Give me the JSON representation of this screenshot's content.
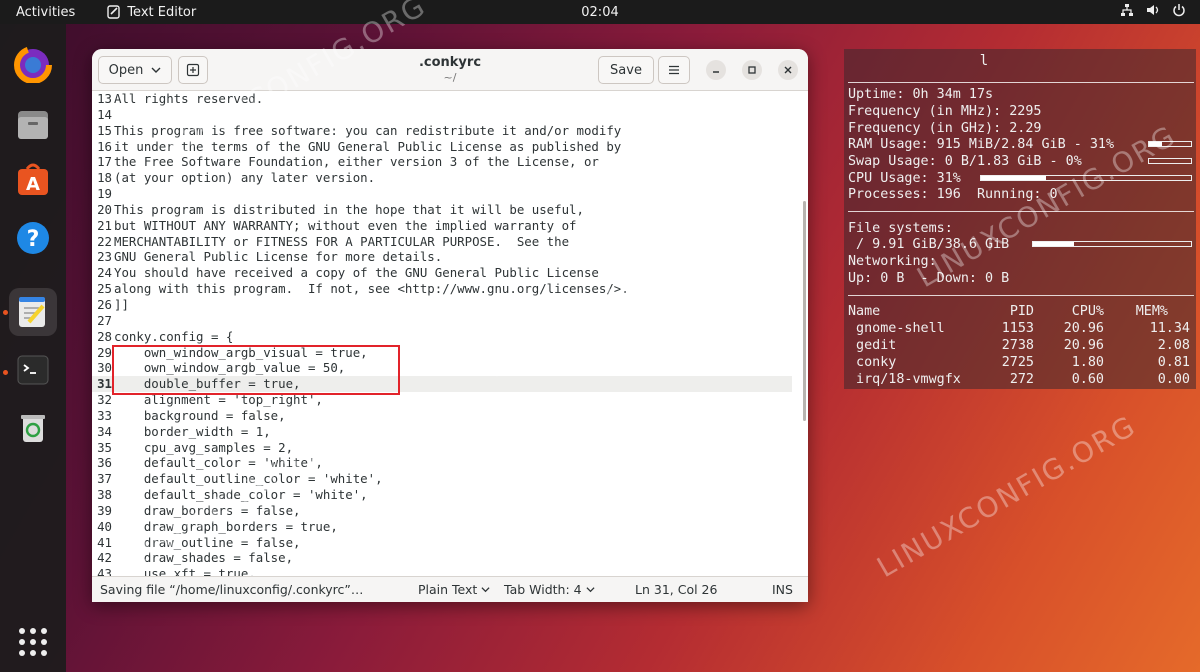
{
  "topbar": {
    "activities": "Activities",
    "app_name": "Text Editor",
    "clock": "02:04"
  },
  "window": {
    "open_label": "Open",
    "title": ".conkyrc",
    "subtitle": "~/",
    "save_label": "Save"
  },
  "editor": {
    "current_line": 31,
    "lines": [
      {
        "n": "13",
        "t": "All rights reserved."
      },
      {
        "n": "14",
        "t": ""
      },
      {
        "n": "15",
        "t": "This program is free software: you can redistribute it and/or modify"
      },
      {
        "n": "16",
        "t": "it under the terms of the GNU General Public License as published by"
      },
      {
        "n": "17",
        "t": "the Free Software Foundation, either version 3 of the License, or"
      },
      {
        "n": "18",
        "t": "(at your option) any later version."
      },
      {
        "n": "19",
        "t": ""
      },
      {
        "n": "20",
        "t": "This program is distributed in the hope that it will be useful,"
      },
      {
        "n": "21",
        "t": "but WITHOUT ANY WARRANTY; without even the implied warranty of"
      },
      {
        "n": "22",
        "t": "MERCHANTABILITY or FITNESS FOR A PARTICULAR PURPOSE.  See the"
      },
      {
        "n": "23",
        "t": "GNU General Public License for more details."
      },
      {
        "n": "24",
        "t": "You should have received a copy of the GNU General Public License"
      },
      {
        "n": "25",
        "t": "along with this program.  If not, see <http://www.gnu.org/licenses/>."
      },
      {
        "n": "26",
        "t": "]]"
      },
      {
        "n": "27",
        "t": ""
      },
      {
        "n": "28",
        "t": "conky.config = {"
      },
      {
        "n": "29",
        "t": "    own_window_argb_visual = true,"
      },
      {
        "n": "30",
        "t": "    own_window_argb_value = 50,"
      },
      {
        "n": "31",
        "t": "    double_buffer = true,"
      },
      {
        "n": "32",
        "t": "    alignment = 'top_right',"
      },
      {
        "n": "33",
        "t": "    background = false,"
      },
      {
        "n": "34",
        "t": "    border_width = 1,"
      },
      {
        "n": "35",
        "t": "    cpu_avg_samples = 2,"
      },
      {
        "n": "36",
        "t": "    default_color = 'white',"
      },
      {
        "n": "37",
        "t": "    default_outline_color = 'white',"
      },
      {
        "n": "38",
        "t": "    default_shade_color = 'white',"
      },
      {
        "n": "39",
        "t": "    draw_borders = false,"
      },
      {
        "n": "40",
        "t": "    draw_graph_borders = true,"
      },
      {
        "n": "41",
        "t": "    draw_outline = false,"
      },
      {
        "n": "42",
        "t": "    draw_shades = false,"
      },
      {
        "n": "43",
        "t": "    use_xft = true,"
      }
    ]
  },
  "statusbar": {
    "message": "Saving file “/home/linuxconfig/.conkyrc”…",
    "language": "Plain Text",
    "tab_width": "Tab Width: 4",
    "position": "Ln 31, Col 26",
    "mode": "INS"
  },
  "conky": {
    "title": "l",
    "uptime": "Uptime: 0h 34m 17s",
    "freq_mhz": "Frequency (in MHz): 2295",
    "freq_ghz": "Frequency (in GHz): 2.29",
    "ram": "RAM Usage: 915 MiB/2.84 GiB - 31%",
    "ram_pct": 31,
    "swap": "Swap Usage: 0 B/1.83 GiB - 0%",
    "swap_pct": 0,
    "cpu": "CPU Usage: 31%",
    "cpu_pct": 31,
    "processes": "Processes: 196  Running: 0",
    "fs_header": "File systems:",
    "fs_root": " / 9.91 GiB/38.6 GiB",
    "fs_pct": 26,
    "net_header": "Networking:",
    "net": "Up: 0 B  - Down: 0 B",
    "proc_headers": {
      "name": "Name",
      "pid": "PID",
      "cpu": "CPU%",
      "mem": "MEM%"
    },
    "procs": [
      {
        "name": " gnome-shell",
        "pid": "1153",
        "cpu": "20.96",
        "mem": "11.34"
      },
      {
        "name": " gedit",
        "pid": "2738",
        "cpu": "20.96",
        "mem": "2.08"
      },
      {
        "name": " conky",
        "pid": "2725",
        "cpu": "1.80",
        "mem": "0.81"
      },
      {
        "name": " irq/18-vmwgfx",
        "pid": "272",
        "cpu": "0.60",
        "mem": "0.00"
      }
    ]
  },
  "watermark": "LINUXCONFIG.ORG"
}
